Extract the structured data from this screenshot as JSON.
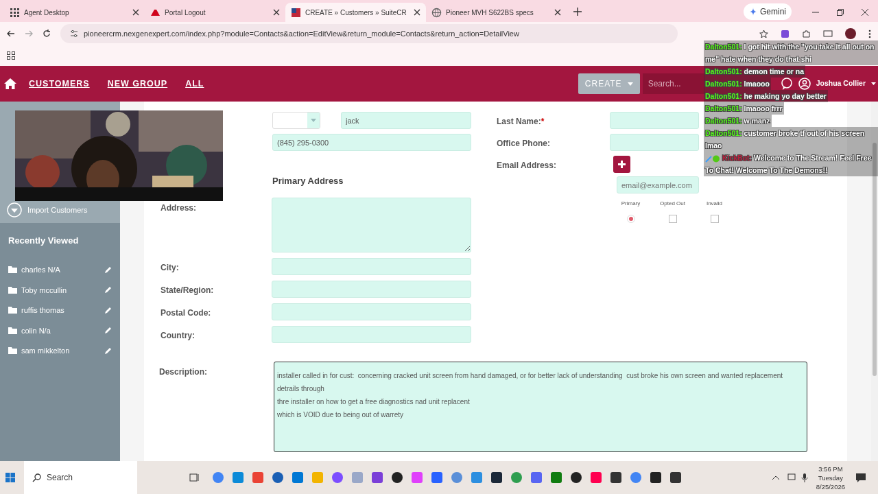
{
  "browser": {
    "tabs": [
      {
        "title": "Agent Desktop",
        "selected": false
      },
      {
        "title": "Portal Logout",
        "selected": false
      },
      {
        "title": "CREATE » Customers » SuiteCR",
        "selected": true
      },
      {
        "title": "Pioneer MVH S622BS specs",
        "selected": false
      }
    ],
    "gemini": "Gemini",
    "url": "pioneercrm.nexgenexpert.com/index.php?module=Contacts&action=EditView&return_module=Contacts&return_action=DetailView"
  },
  "nav": {
    "items": [
      "CUSTOMERS",
      "NEW GROUP",
      "ALL"
    ],
    "create": "CREATE",
    "search_placeholder": "Search...",
    "user": "Joshua Collier"
  },
  "sidebar": {
    "actions": [
      "Import Customers"
    ],
    "recent_title": "Recently Viewed",
    "recent": [
      "charles N/A",
      "Toby mccullin",
      "ruffis thomas",
      "colin N/a",
      "sam mikkelton"
    ]
  },
  "form": {
    "first_name": "jack",
    "phone": "(845) 295-0300",
    "right_fields": [
      {
        "label": "Last Name:",
        "required": true,
        "kind": "input"
      },
      {
        "label": "Office Phone:",
        "required": false,
        "kind": "input"
      },
      {
        "label": "Email Address:",
        "required": false,
        "kind": "email"
      }
    ],
    "required_mark": "*",
    "email_placeholder": "email@example.com",
    "email_flags": [
      {
        "label": "Primary",
        "kind": "radio",
        "checked": true
      },
      {
        "label": "Opted Out",
        "kind": "checkbox",
        "checked": false
      },
      {
        "label": "Invalid",
        "kind": "checkbox",
        "checked": false
      }
    ],
    "address_heading": "Primary Address",
    "address_fields": [
      {
        "label": "Address:",
        "kind": "textarea"
      },
      {
        "label": "City:",
        "kind": "input"
      },
      {
        "label": "State/Region:",
        "kind": "input"
      },
      {
        "label": "Postal Code:",
        "kind": "input"
      },
      {
        "label": "Country:",
        "kind": "input"
      }
    ],
    "description_label": "Description:",
    "description": "installer called in for cust:  concerning cracked unit screen from hand damaged, or for better lack of understanding  cust broke his own screen and wanted replacement detrails through\nthre installer on how to get a free diagnostics nad unit replacent\nwhich is VOID due to being out of warrety"
  },
  "chat": [
    {
      "kind": "user",
      "user": "Dalton501:",
      "text": "I got hit with the \"you take it all out on me\" hate when they do that shi"
    },
    {
      "kind": "user",
      "user": "Dalton501:",
      "text": "demon time or na"
    },
    {
      "kind": "user",
      "user": "Dalton501:",
      "text": "lmaooo"
    },
    {
      "kind": "user",
      "user": "Dalton501:",
      "text": "he making yo day better"
    },
    {
      "kind": "user",
      "user": "Dalton501:",
      "text": "lmaooo frrr"
    },
    {
      "kind": "user",
      "user": "Dalton501:",
      "text": "w manz"
    },
    {
      "kind": "user",
      "user": "Dalton501:",
      "text": "customer broke tf out of his screen lmao"
    },
    {
      "kind": "bot",
      "user": "KickBot:",
      "text": "Welcome to The Stream! Feel Free To Chat! Welcome To The Demons!!"
    }
  ],
  "taskbar": {
    "search": "Search",
    "time": "3:56 PM",
    "day": "Tuesday",
    "date": "8/25/2026"
  }
}
